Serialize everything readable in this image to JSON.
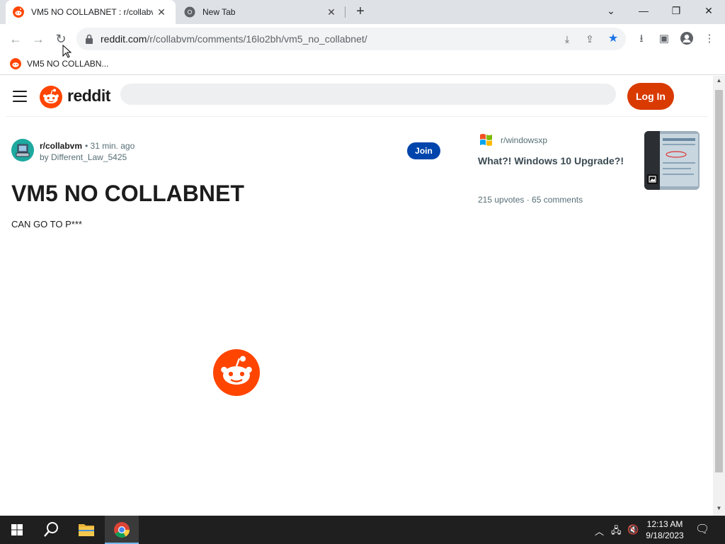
{
  "browser": {
    "tabs": [
      {
        "title": "VM5 NO COLLABNET : r/collabvm",
        "active": true
      },
      {
        "title": "New Tab",
        "active": false
      }
    ],
    "new_tab_symbol": "+",
    "url_host": "reddit.com",
    "url_path": "/r/collabvm/comments/16lo2bh/vm5_no_collabnet/",
    "bookmark_label": "VM5 NO COLLABN..."
  },
  "reddit": {
    "wordmark": "reddit",
    "search_placeholder": "",
    "login_label": "Log In",
    "brand_color": "#ff4500",
    "login_color": "#d93a00",
    "join_color": "#0045ac"
  },
  "post": {
    "subreddit": "r/collabvm",
    "time": "• 31 min. ago",
    "author": "by Different_Law_5425",
    "join_label": "Join",
    "title": "VM5 NO COLLABNET",
    "body": "CAN GO TO P***"
  },
  "related": {
    "subreddit": "r/windowsxp",
    "title": "What?! Windows 10 Upgrade?!",
    "stats": "215 upvotes · 65 comments"
  },
  "taskbar": {
    "time": "12:13 AM",
    "date": "9/18/2023"
  }
}
